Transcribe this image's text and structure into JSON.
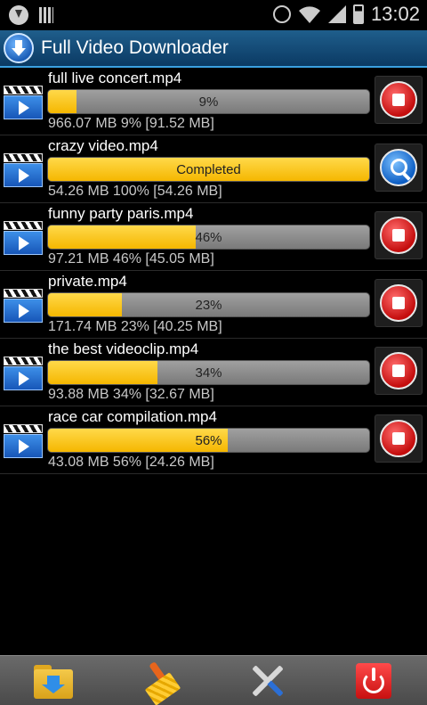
{
  "status_bar": {
    "time": "13:02",
    "icons": [
      "download-notification-icon",
      "bars-notification-icon",
      "alarm-icon",
      "wifi-icon",
      "signal-icon",
      "battery-icon"
    ]
  },
  "app": {
    "title": "Full Video Downloader",
    "icon": "download-arrow-icon"
  },
  "downloads": [
    {
      "filename": "full live concert.mp4",
      "progress_label": "9%",
      "progress_percent": 9,
      "size_info": "966.07 MB 9% [91.52 MB]",
      "action": "stop"
    },
    {
      "filename": "crazy video.mp4",
      "progress_label": "Completed",
      "progress_percent": 100,
      "size_info": "54.26 MB 100% [54.26 MB]",
      "action": "search"
    },
    {
      "filename": "funny party paris.mp4",
      "progress_label": "46%",
      "progress_percent": 46,
      "size_info": "97.21 MB 46% [45.05 MB]",
      "action": "stop"
    },
    {
      "filename": "private.mp4",
      "progress_label": "23%",
      "progress_percent": 23,
      "size_info": "171.74 MB 23% [40.25 MB]",
      "action": "stop"
    },
    {
      "filename": "the best videoclip.mp4",
      "progress_label": "34%",
      "progress_percent": 34,
      "size_info": "93.88 MB 34% [32.67 MB]",
      "action": "stop"
    },
    {
      "filename": "race car compilation.mp4",
      "progress_label": "56%",
      "progress_percent": 56,
      "size_info": "43.08 MB 56% [24.26 MB]",
      "action": "stop"
    }
  ],
  "toolbar": {
    "buttons": [
      "folder-download-icon",
      "broom-clean-icon",
      "tools-settings-icon",
      "power-exit-icon"
    ]
  },
  "colors": {
    "accent": "#1f5e8c",
    "progress_fill": "#f5b700",
    "stop": "#c40d0d",
    "search": "#0d5ec4"
  }
}
